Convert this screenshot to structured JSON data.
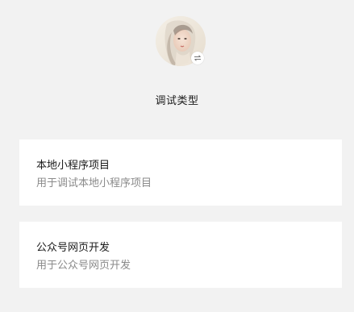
{
  "header": {
    "avatar_icon": "user-avatar-portrait",
    "switch_icon": "switch-arrows-icon",
    "title": "调试类型"
  },
  "options": [
    {
      "title": "本地小程序项目",
      "description": "用于调试本地小程序项目"
    },
    {
      "title": "公众号网页开发",
      "description": "用于公众号网页开发"
    }
  ],
  "colors": {
    "background": "#f2f2f2",
    "card": "#ffffff",
    "title_text": "#1a1a1a",
    "secondary_text": "#8a8a8a"
  }
}
